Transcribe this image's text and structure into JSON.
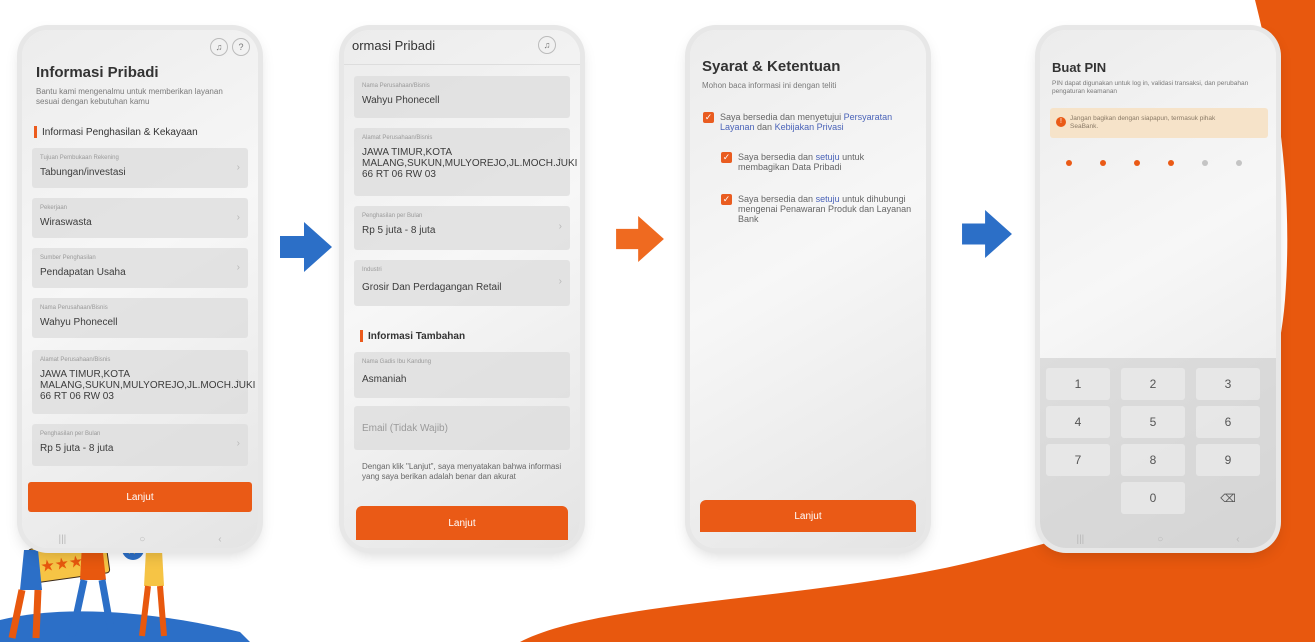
{
  "screens": {
    "s1": {
      "title": "Informasi Pribadi",
      "subtitle": "Bantu kami mengenalmu untuk memberikan layanan sesuai dengan kebutuhan kamu",
      "section": "Informasi Penghasilan & Kekayaan",
      "fields": [
        {
          "label": "Tujuan Pembukaan Rekening",
          "value": "Tabungan/investasi"
        },
        {
          "label": "Pekerjaan",
          "value": "Wiraswasta"
        },
        {
          "label": "Sumber Penghasilan",
          "value": "Pendapatan Usaha"
        },
        {
          "label": "Nama Perusahaan/Bisnis",
          "value": "Wahyu Phonecell"
        },
        {
          "label": "Alamat Perusahaan/Bisnis",
          "value": "JAWA TIMUR,KOTA MALANG,SUKUN,MULYOREJO,JL.MOCH.JUKI 66 RT 06 RW 03"
        },
        {
          "label": "Penghasilan per Bulan",
          "value": "Rp 5 juta - 8 juta"
        }
      ],
      "button": "Lanjut"
    },
    "s2": {
      "title": "ormasi Pribadi",
      "fields": [
        {
          "label": "Nama Perusahaan/Bisnis",
          "value": "Wahyu Phonecell"
        },
        {
          "label": "Alamat Perusahaan/Bisnis",
          "value": "JAWA TIMUR,KOTA MALANG,SUKUN,MULYOREJO,JL.MOCH.JUKI 66 RT 06 RW 03"
        },
        {
          "label": "Penghasilan per Bulan",
          "value": "Rp 5 juta - 8 juta"
        },
        {
          "label": "Industri",
          "value": "Grosir Dan Perdagangan Retail"
        }
      ],
      "section": "Informasi Tambahan",
      "mother_label": "Nama Gadis Ibu Kandung",
      "mother_value": "Asmaniah",
      "email_placeholder": "Email (Tidak Wajib)",
      "disclaimer": "Dengan klik \"Lanjut\", saya menyatakan bahwa informasi yang saya berikan adalah benar dan akurat",
      "button": "Lanjut"
    },
    "s3": {
      "title": "Syarat & Ketentuan",
      "subtitle": "Mohon baca informasi ini dengan teliti",
      "c1_pre": "Saya bersedia dan menyetujui ",
      "c1_link1": "Persyaratan Layanan",
      "c1_mid": " dan ",
      "c1_link2": "Kebijakan Privasi",
      "c2_pre": "Saya bersedia dan ",
      "c2_link": "setuju",
      "c2_post": " untuk membagikan Data Pribadi",
      "c3_pre": "Saya bersedia dan ",
      "c3_link": "setuju",
      "c3_post": " untuk dihubungi mengenai Penawaran Produk dan Layanan Bank",
      "button": "Lanjut"
    },
    "s4": {
      "title": "Buat PIN",
      "subtitle": "PIN dapat digunakan untuk log in, validasi transaksi, dan perubahan pengaturan keamanan",
      "warning": "Jangan bagikan dengan siapapun, termasuk pihak SeaBank.",
      "pin_filled": 4,
      "pin_total": 6,
      "keys": [
        "1",
        "2",
        "3",
        "4",
        "5",
        "6",
        "7",
        "8",
        "9",
        "",
        "0",
        "⌫"
      ]
    }
  },
  "colors": {
    "accent": "#ea5a16",
    "arrow_blue": "#2c6fc7",
    "arrow_orange": "#ef6a20",
    "link": "#4a63b8"
  },
  "icons": [
    "bell-icon",
    "help-icon",
    "chevron-right-icon",
    "check-icon",
    "warning-icon",
    "backspace-icon",
    "arrow-right-icon"
  ]
}
